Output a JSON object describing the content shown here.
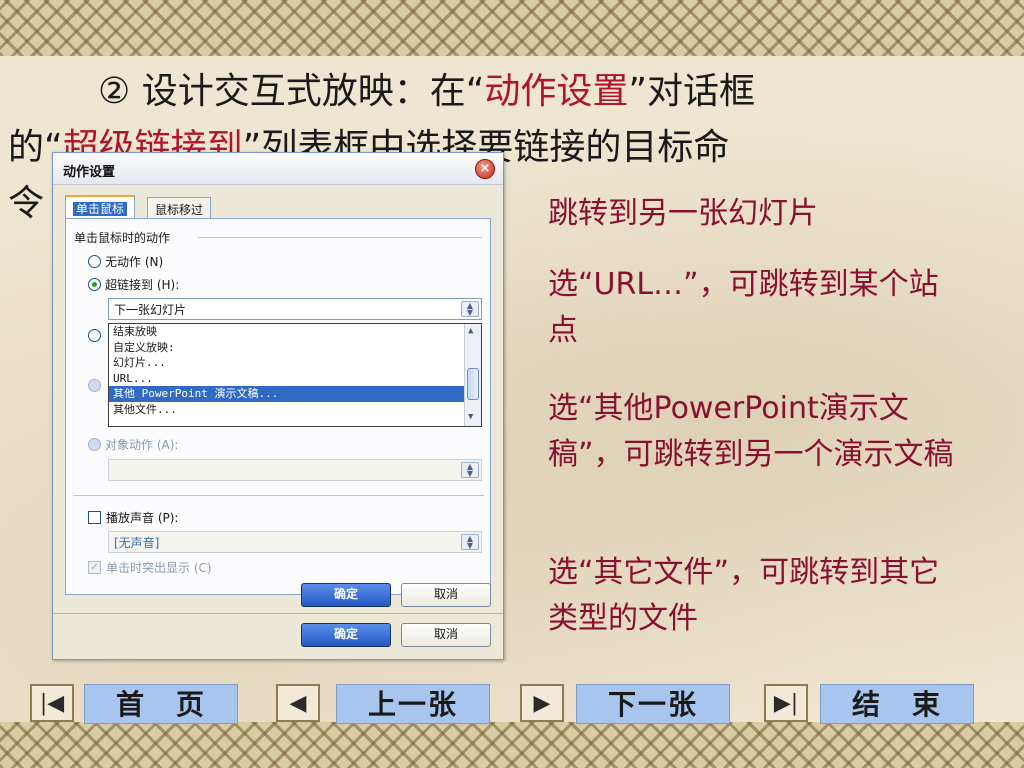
{
  "headline": {
    "marker": "②",
    "prefix": " 设计交互式放映：在“",
    "hl1": "动作设置",
    "mid": "”对话框",
    "line2_prefix": "的“",
    "hl2": "超级链接到",
    "line2_suffix": "”列表框中选择要链接的目标命",
    "line3": "令"
  },
  "notes": [
    {
      "text": "跳转到另一张幻灯片"
    },
    {
      "text": "选“URL…”，可跳转到某个站点"
    },
    {
      "text": "选“其他PowerPoint演示文稿”，可跳转到另一个演示文稿"
    },
    {
      "text": "选“其它文件”，可跳转到其它类型的文件"
    }
  ],
  "dialog": {
    "title": "动作设置",
    "close_icon": "×",
    "tabs": [
      "单击鼠标",
      "鼠标移过"
    ],
    "group_label": "单击鼠标时的动作",
    "options": {
      "none": "无动作 (N)",
      "hyperlink": "超链接到 (H):",
      "object_action": "对象动作 (A):"
    },
    "hyperlink_value": "下一张幻灯片",
    "list_items": [
      "结束放映",
      "自定义放映:",
      "幻灯片...",
      "URL...",
      "其他 PowerPoint 演示文稿...",
      "其他文件..."
    ],
    "selected_index": 4,
    "object_action_value": "",
    "sound": {
      "label": "播放声音 (P):",
      "value": "[无声音]"
    },
    "highlight": "单击时突出显示 (C)",
    "ok": "确定",
    "cancel": "取消"
  },
  "nav": {
    "first": "首　页",
    "prev": "上一张",
    "next": "下一张",
    "end": "结　束",
    "icons": [
      "first-slide-icon",
      "prev-slide-icon",
      "next-slide-icon",
      "last-slide-icon"
    ]
  },
  "colors": {
    "highlight": "#b0152a",
    "note": "#8a1030",
    "nav_button": "#a7c5ed",
    "selection": "#316ac5"
  }
}
